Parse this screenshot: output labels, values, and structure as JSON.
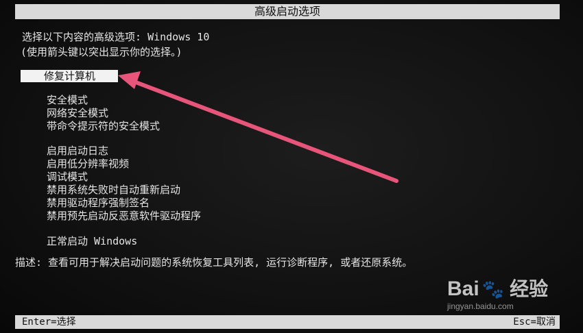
{
  "window": {
    "title": "高级启动选项"
  },
  "prompt": {
    "line1": "选择以下内容的高级选项: Windows 10",
    "line2": "(使用箭头键以突出显示你的选择。)"
  },
  "menu": {
    "selected": "修复计算机",
    "group1": [
      "安全模式",
      "网络安全模式",
      "带命令提示符的安全模式"
    ],
    "group2": [
      "启用启动日志",
      "启用低分辨率视频",
      "调试模式",
      "禁用系统失败时自动重新启动",
      "禁用驱动程序强制签名",
      "禁用预先启动反恶意软件驱动程序"
    ],
    "group3": [
      "正常启动 Windows"
    ]
  },
  "description": "描述: 查看可用于解决启动问题的系统恢复工具列表, 运行诊断程序, 或者还原系统。",
  "footer": {
    "left": "Enter=选择",
    "right": "Esc=取消"
  },
  "annotation": {
    "arrow_color": "#e8557a",
    "arrow_icon": "arrow-pointer-icon"
  },
  "watermark": {
    "brand": "Bai",
    "brand_suffix": "经验",
    "paw_icon": "baidu-paw-icon",
    "url": "jingyan.baidu.com"
  }
}
